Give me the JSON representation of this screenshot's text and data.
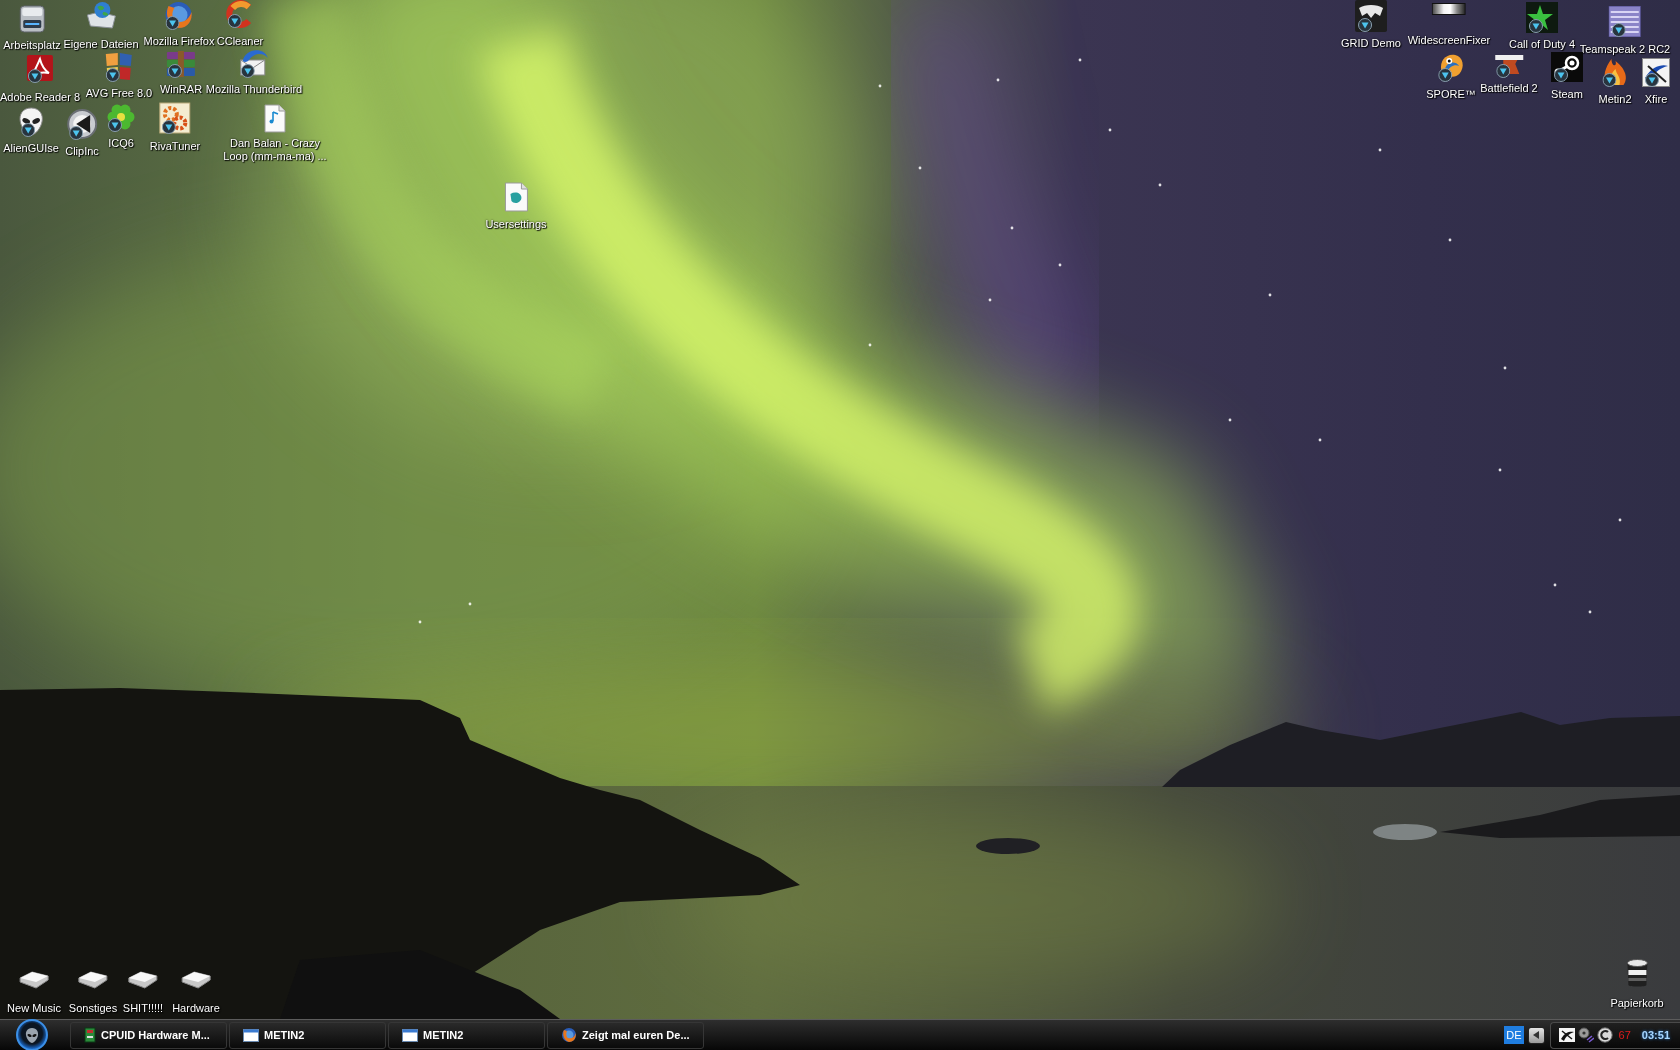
{
  "desktop": {
    "icons": [
      {
        "label": "Arbeitsplatz",
        "shortcut": false
      },
      {
        "label": "Eigene Dateien",
        "shortcut": false
      },
      {
        "label": "Mozilla Firefox",
        "shortcut": true
      },
      {
        "label": "CCleaner",
        "shortcut": true
      },
      {
        "label": "Adobe Reader 8",
        "shortcut": true
      },
      {
        "label": "AVG Free 8.0",
        "shortcut": true
      },
      {
        "label": "WinRAR",
        "shortcut": true
      },
      {
        "label": "Mozilla Thunderbird",
        "shortcut": true
      },
      {
        "label": "AlienGUIse",
        "shortcut": true
      },
      {
        "label": "ClipInc",
        "shortcut": true
      },
      {
        "label": "ICQ6",
        "shortcut": true
      },
      {
        "label": "RivaTuner",
        "shortcut": true
      },
      {
        "label": "Dan Balan - Crazy Loop (mm-ma-ma) ...",
        "shortcut": false
      },
      {
        "label": "Usersettings",
        "shortcut": false
      },
      {
        "label": "GRID Demo",
        "shortcut": true
      },
      {
        "label": "WidescreenFixer",
        "shortcut": false
      },
      {
        "label": "Call of Duty 4",
        "shortcut": true
      },
      {
        "label": "Teamspeak 2 RC2",
        "shortcut": true
      },
      {
        "label": "SPORE™",
        "shortcut": true
      },
      {
        "label": "Battlefield 2",
        "shortcut": true
      },
      {
        "label": "Steam",
        "shortcut": true
      },
      {
        "label": "Metin2",
        "shortcut": true
      },
      {
        "label": "Xfire",
        "shortcut": true
      },
      {
        "label": "New Music",
        "shortcut": false
      },
      {
        "label": "Sonstiges",
        "shortcut": false
      },
      {
        "label": "SHIT!!!!!",
        "shortcut": false
      },
      {
        "label": "Hardware",
        "shortcut": false
      },
      {
        "label": "Papierkorb",
        "shortcut": false
      }
    ]
  },
  "taskbar": {
    "windows": [
      {
        "label": "CPUID Hardware M...",
        "selected": false
      },
      {
        "label": "METIN2",
        "selected": false
      },
      {
        "label": "METIN2",
        "selected": false
      },
      {
        "label": "Zeigt mal euren De...",
        "selected": false
      }
    ],
    "tray": {
      "language": "DE",
      "reading": "67",
      "clock": "03:51"
    }
  }
}
